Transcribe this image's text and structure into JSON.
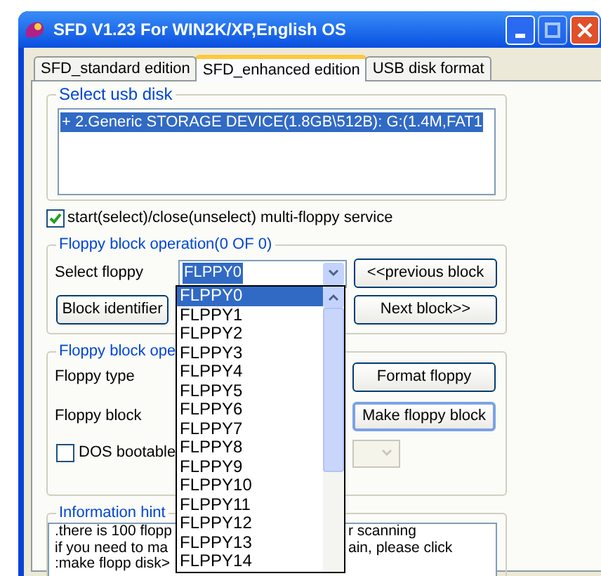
{
  "window": {
    "title": "SFD V1.23 For WIN2K/XP,English OS"
  },
  "tabs": [
    {
      "label": "SFD_standard edition",
      "selected": false
    },
    {
      "label": "SFD_enhanced edition",
      "selected": true
    },
    {
      "label": "USB disk format",
      "selected": false
    }
  ],
  "usb_group": {
    "label": "Select usb disk",
    "items": [
      {
        "text": "+ 2.Generic STORAGE DEVICE(1.8GB\\512B): G:(1.4M,FAT1",
        "selected": true
      }
    ]
  },
  "multi_floppy": {
    "label": "start(select)/close(unselect) multi-floppy service",
    "checked": true
  },
  "block_group": {
    "label": "Floppy block operation(0 OF 0)",
    "select_label": "Select floppy",
    "select_value": "FLPPY0",
    "previous_button": "<<previous block",
    "identifier_button": "Block identifier",
    "next_button": "Next block>>"
  },
  "op_group": {
    "label": "Floppy block ope",
    "type_label": "Floppy type",
    "block_label": "Floppy block",
    "format_button": "Format floppy",
    "make_button": "Make floppy block",
    "dos_bootable": {
      "label": "DOS bootable",
      "checked": false
    },
    "boot_select": {
      "disabled": true
    }
  },
  "hint": {
    "label": "Information hint",
    "lines": [
      {
        "left": ".there is 100 flopp",
        "right": "r scanning"
      },
      {
        "left": "if you need to ma",
        "right": "ain, please click"
      },
      {
        "left": ":make flopp disk>"
      }
    ]
  },
  "dropdown": {
    "items": [
      {
        "text": "FLPPY0",
        "selected": true
      },
      {
        "text": "FLPPY1",
        "selected": false
      },
      {
        "text": "FLPPY2",
        "selected": false
      },
      {
        "text": "FLPPY3",
        "selected": false
      },
      {
        "text": "FLPPY4",
        "selected": false
      },
      {
        "text": "FLPPY5",
        "selected": false
      },
      {
        "text": "FLPPY6",
        "selected": false
      },
      {
        "text": "FLPPY7",
        "selected": false
      },
      {
        "text": "FLPPY8",
        "selected": false
      },
      {
        "text": "FLPPY9",
        "selected": false
      },
      {
        "text": "FLPPY10",
        "selected": false
      },
      {
        "text": "FLPPY11",
        "selected": false
      },
      {
        "text": "FLPPY12",
        "selected": false
      },
      {
        "text": "FLPPY13",
        "selected": false
      },
      {
        "text": "FLPPY14",
        "selected": false
      }
    ]
  }
}
